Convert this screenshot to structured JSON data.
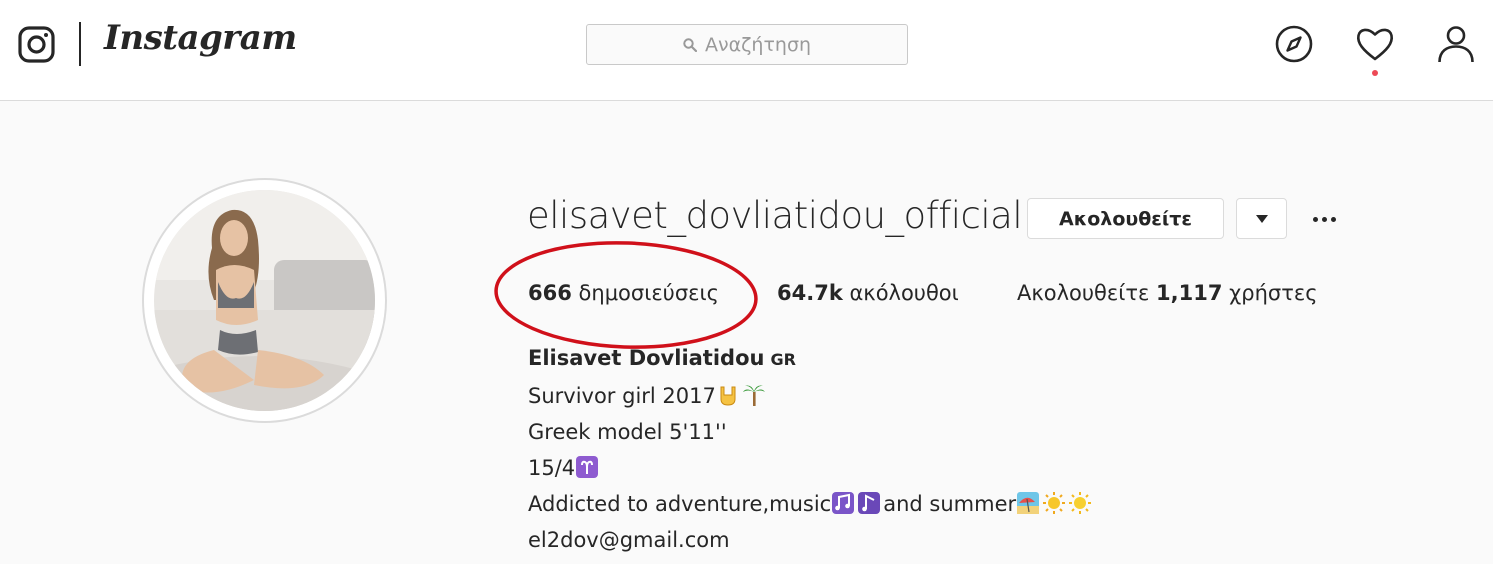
{
  "header": {
    "brand": "Instagram",
    "search": {
      "placeholder": "Αναζήτηση"
    }
  },
  "profile": {
    "username": "elisavet_dovliatidou_official",
    "follow_button_label": "Ακολουθείτε",
    "stats": {
      "posts_count": "666",
      "posts_label": "δημοσιεύσεις",
      "followers_count": "64.7k",
      "followers_label": "ακόλουθοι",
      "following_prefix": "Ακολουθείτε",
      "following_count": "1,117",
      "following_label": "χρήστες"
    },
    "bio": {
      "full_name": "Elisavet Dovliatidou",
      "name_suffix": "GR",
      "line1": "Survivor girl 2017",
      "line2": "Greek model 5'11''",
      "line3": "15/4",
      "line4_a": "Addicted to adventure,music",
      "line4_b": "and summer",
      "line5": "el2dov@gmail.com"
    }
  },
  "annotation": {
    "color": "#d0101a"
  },
  "colors": {
    "notification_dot": "#ed4956",
    "border": "#dbdbdb",
    "text": "#262626"
  }
}
